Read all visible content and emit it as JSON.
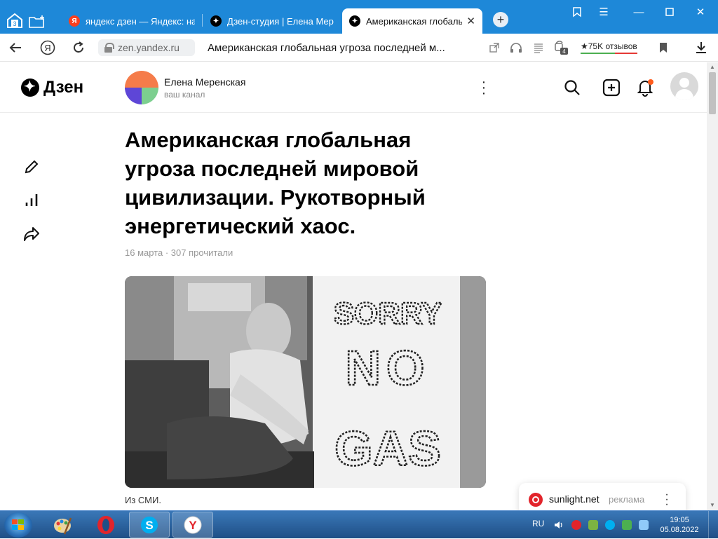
{
  "browser": {
    "tabs_count": "3",
    "tabs": [
      {
        "title": "яндекс дзен — Яндекс: на",
        "favicon": "yandex-icon",
        "color": "#fc3f1d",
        "active": false
      },
      {
        "title": "Дзен-студия | Елена Мере",
        "favicon": "zen-icon",
        "color": "#000000",
        "active": false
      },
      {
        "title": "Американская глобальна",
        "favicon": "zen-icon",
        "color": "#000000",
        "active": true
      }
    ],
    "new_tab": "+",
    "url": "zen.yandex.ru",
    "address_title": "Американская глобальная угроза последней м...",
    "reviews": "★75K отзывов",
    "badge_count": "4"
  },
  "header": {
    "logo": "Дзен",
    "channel_name": "Елена Меренская",
    "channel_sub": "ваш канал"
  },
  "article": {
    "title": "Американская глобальная угроза последней мировой цивилизации. Рукотворный энергетический хаос.",
    "meta": "16 марта · 307 прочитали",
    "image_text_lines": [
      "SORRY",
      "NO",
      "GAS"
    ],
    "caption": "Из СМИ."
  },
  "ad": {
    "site": "sunlight.net",
    "label": "реклама"
  },
  "taskbar": {
    "lang": "RU",
    "time": "19:05",
    "date": "05.08.2022"
  },
  "colors": {
    "titlebar": "#1e88d8",
    "notification_dot": "#ff5c1c",
    "ad_brand": "#e2242b"
  }
}
